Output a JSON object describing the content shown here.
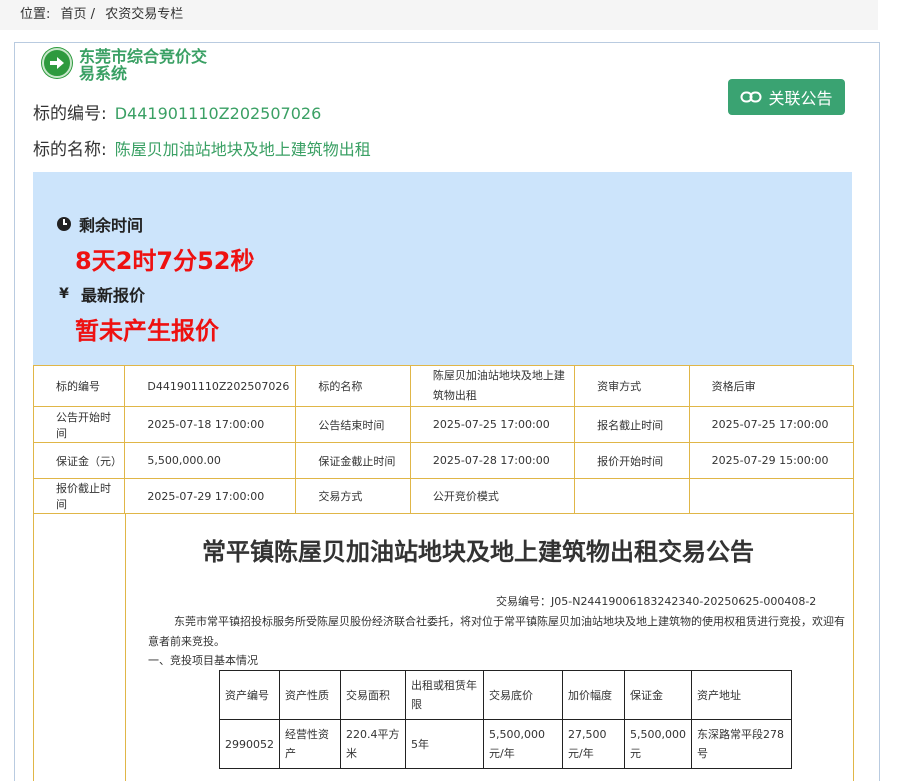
{
  "breadcrumb": {
    "label": "位置:",
    "home": "首页 /",
    "current": "农资交易专栏"
  },
  "system": {
    "title": "东莞市综合竞价交易系统"
  },
  "subject": {
    "number_label": "标的编号:",
    "number": "D441901110Z202507026",
    "name_label": "标的名称:",
    "name": "陈屋贝加油站地块及地上建筑物出租"
  },
  "actions": {
    "related_notice": "关联公告"
  },
  "auction": {
    "remaining_label": "剩余时间",
    "remaining": "8天2时7分52秒",
    "latest_bid_label": "最新报价",
    "latest_bid": "暂未产生报价",
    "yen_symbol": "¥"
  },
  "info_table": {
    "rows": [
      [
        "标的编号",
        "D441901110Z202507026",
        "标的名称",
        "陈屋贝加油站地块及地上建筑物出租",
        "资审方式",
        "资格后审"
      ],
      [
        "公告开始时间",
        "2025-07-18 17:00:00",
        "公告结束时间",
        "2025-07-25 17:00:00",
        "报名截止时间",
        "2025-07-25 17:00:00"
      ],
      [
        "保证金（元）",
        "5,500,000.00",
        "保证金截止时间",
        "2025-07-28 17:00:00",
        "报价开始时间",
        "2025-07-29 15:00:00"
      ],
      [
        "报价截止时间",
        "2025-07-29 17:00:00",
        "交易方式",
        "公开竞价模式",
        "",
        ""
      ]
    ]
  },
  "notice": {
    "title": "常平镇陈屋贝加油站地块及地上建筑物出租交易公告",
    "trade_no": "交易编号：J05-N24419006183242340-20250625-000408-2",
    "intro": "东莞市常平镇招投标服务所受陈屋贝股份经济联合社委托，将对位于常平镇陈屋贝加油站地块及地上建筑物的使用权租赁进行竞投，欢迎有意者前来竞投。",
    "section1": "一、竞投项目基本情况",
    "asset_headers": [
      "资产编号",
      "资产性质",
      "交易面积",
      "出租或租赁年限",
      "交易底价",
      "加价幅度",
      "保证金",
      "资产地址"
    ],
    "asset_row": [
      "2990052",
      "经营性资产",
      "220.4平方米",
      "5年",
      "5,500,000元/年",
      "27,500元/年",
      "5,500,000元",
      "东深路常平段278号"
    ]
  },
  "colors": {
    "accent_green": "#3aa064",
    "button_green": "#3aa372",
    "timer_bg": "#cce4fb",
    "alert_red": "#ee1111",
    "table_border": "#e0b648"
  }
}
